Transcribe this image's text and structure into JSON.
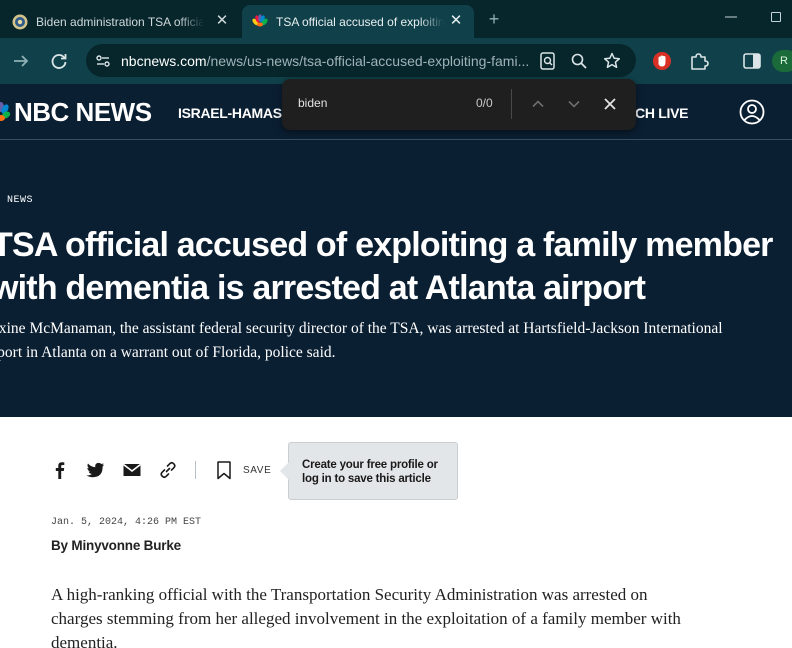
{
  "browser": {
    "tabs": [
      {
        "title": "Biden administration TSA official accused of",
        "icon": "site-favicon",
        "active": false
      },
      {
        "title": "TSA official accused of exploiting a family member",
        "icon": "nbc-peacock-favicon",
        "active": true
      }
    ],
    "tab_close_glyph": "✕",
    "new_tab_glyph": "+",
    "url": {
      "host": "nbcnews.com",
      "path": "/news/us-news/tsa-official-accused-exploiting-fami..."
    },
    "extension_badge": "R"
  },
  "find_bar": {
    "query": "biden",
    "count": "0/0"
  },
  "site": {
    "logo": "NBC NEWS",
    "nav_item": "ISRAEL-HAMAS WA",
    "watch_live": "ATCH LIVE"
  },
  "article": {
    "kicker": ". NEWS",
    "headline_line1": "TSA official accused of exploiting a family member",
    "headline_line2": "with dementia is arrested at Atlanta airport",
    "dek_line1": "axine McManaman, the assistant federal security director of the TSA, was arrested at Hartsfield-Jackson International",
    "dek_line2": "rport in Atlanta on a warrant out of Florida, police said.",
    "save_label": "SAVE",
    "tooltip": "Create your free profile or log in to save this article",
    "date": "Jan. 5, 2024, 4:26 PM EST",
    "byline_prefix": "By",
    "author": "Minyvonne Burke",
    "body_line1": "A high-ranking official with the Transportation Security Administration was arrested on",
    "body_line2": "charges stemming from her alleged involvement in the exploitation of a family member with",
    "body_line3": "dementia."
  },
  "colors": {
    "chrome_dark": "#07262b",
    "chrome_toolbar": "#10414a",
    "nbc_navy": "#0b1f33"
  }
}
